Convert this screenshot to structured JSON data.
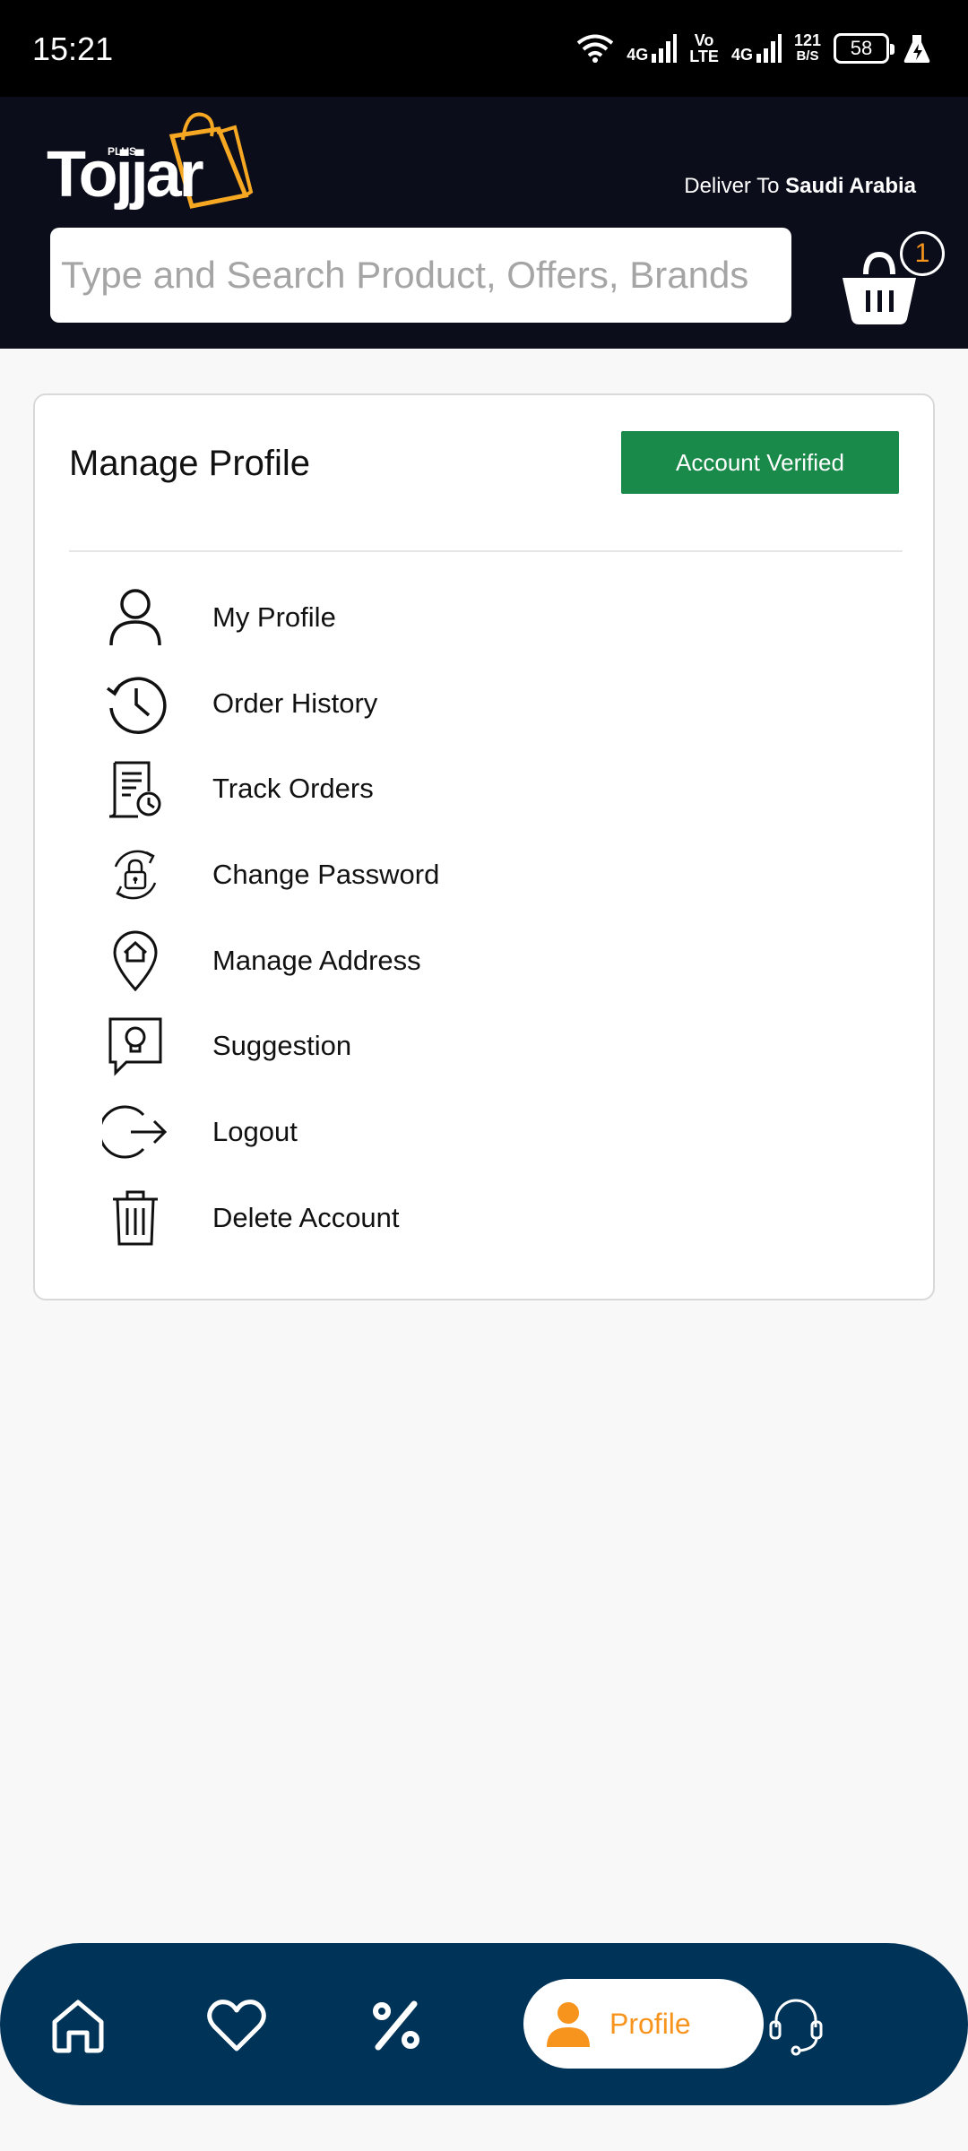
{
  "status_bar": {
    "time": "15:21",
    "net1": "4G",
    "volte": "Vo\nLTE",
    "net2": "4G",
    "speed_value": "121",
    "speed_unit": "B/S",
    "battery": "58"
  },
  "header": {
    "logo_plus": "PLUS",
    "logo_text": "Tojjar",
    "deliver_prefix": "Deliver To ",
    "deliver_country": "Saudi Arabia",
    "search_placeholder": "Type and Search Product, Offers, Brands",
    "cart_count": "1"
  },
  "profile": {
    "title": "Manage Profile",
    "badge": "Account Verified",
    "items": [
      {
        "label": "My Profile",
        "icon": "person-icon"
      },
      {
        "label": "Order History",
        "icon": "history-icon"
      },
      {
        "label": "Track Orders",
        "icon": "track-orders-icon"
      },
      {
        "label": "Change Password",
        "icon": "lock-refresh-icon"
      },
      {
        "label": "Manage Address",
        "icon": "location-home-icon"
      },
      {
        "label": "Suggestion",
        "icon": "lightbulb-chat-icon"
      },
      {
        "label": "Logout",
        "icon": "logout-icon"
      },
      {
        "label": "Delete Account",
        "icon": "trash-icon"
      }
    ]
  },
  "bottom_nav": {
    "items": [
      "home-icon",
      "heart-icon",
      "percent-icon",
      "profile",
      "support-icon"
    ],
    "active_label": "Profile"
  },
  "colors": {
    "header_bg": "#0b0d1a",
    "accent": "#f7941d",
    "verified": "#1a8a4a",
    "nav_bg": "#003358"
  }
}
